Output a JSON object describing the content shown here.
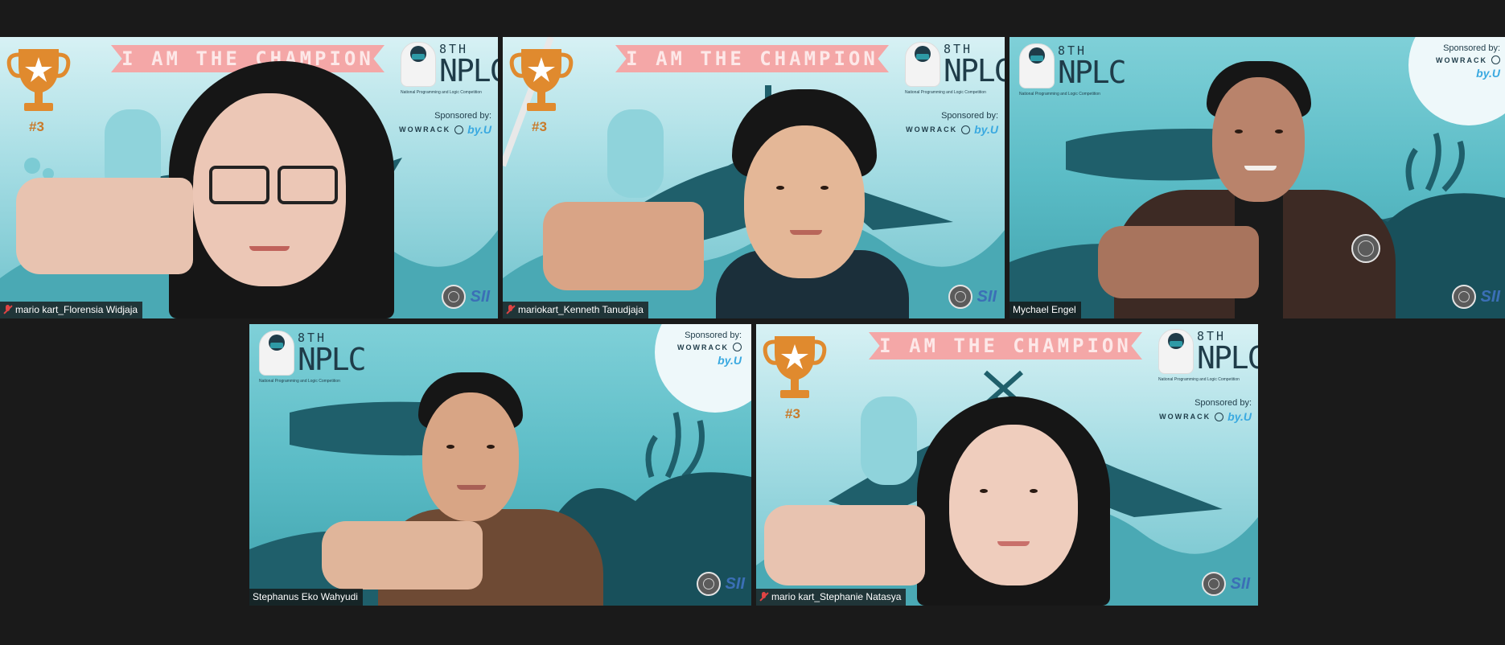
{
  "meeting": {
    "background_color": "#1a1a1a",
    "participants": [
      {
        "display_name": "mario kart_Florensia Widjaja",
        "muted": true
      },
      {
        "display_name": "mariokart_Kenneth Tanudjaja",
        "muted": true
      },
      {
        "display_name": "Mychael Engel",
        "muted": false
      },
      {
        "display_name": "Stephanus Eko Wahyudi",
        "muted": false
      },
      {
        "display_name": "mario kart_Stephanie Natasya",
        "muted": true
      }
    ]
  },
  "virtual_background": {
    "banner_text": "I AM THE CHAMPION",
    "rank": "#3",
    "edition": "8TH",
    "event_name": "NPLC",
    "event_full": "National Programming and Logic Competition",
    "sponsored_by": "Sponsored by:",
    "sponsor_1": "WOWRACK",
    "sponsor_2": "by.U",
    "badge_text": "SII",
    "colors": {
      "banner": "#f4a7a7",
      "trophy": "#e08a2e",
      "logo_navy": "#1f3c49",
      "sea_teal": "#2e7f8c",
      "muted_icon": "#e04444"
    }
  }
}
